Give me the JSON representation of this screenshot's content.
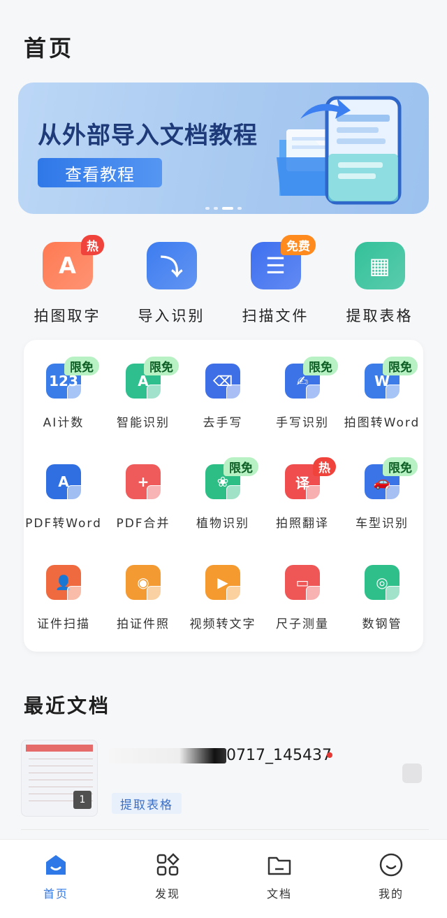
{
  "header": {
    "title": "首页"
  },
  "banner": {
    "title": "从外部导入文档教程",
    "button": "查看教程",
    "slide_count": 4,
    "active_slide": 3
  },
  "top_features": [
    {
      "label": "拍图取字",
      "icon": "photo-text-icon",
      "badge": "热",
      "badge_type": "hot",
      "color": "#ff7a52"
    },
    {
      "label": "导入识别",
      "icon": "import-recognize-icon",
      "badge": "",
      "badge_type": "",
      "color": "#3d7cf0"
    },
    {
      "label": "扫描文件",
      "icon": "scan-file-icon",
      "badge": "免费",
      "badge_type": "free",
      "color": "#3d6ff0"
    },
    {
      "label": "提取表格",
      "icon": "extract-table-icon",
      "badge": "",
      "badge_type": "",
      "color": "#33c19a"
    }
  ],
  "tools": [
    {
      "label": "AI计数",
      "icon": "ai-count-icon",
      "glyph": "123",
      "color": "#3a7de9",
      "badge": "限免",
      "badge_type": "free"
    },
    {
      "label": "智能识别",
      "icon": "smart-recognize-icon",
      "glyph": "A",
      "color": "#2fbf8f",
      "badge": "限免",
      "badge_type": "free"
    },
    {
      "label": "去手写",
      "icon": "remove-handwriting-icon",
      "glyph": "⌫",
      "color": "#3f6fe6",
      "badge": "",
      "badge_type": ""
    },
    {
      "label": "手写识别",
      "icon": "handwriting-recognize-icon",
      "glyph": "✍",
      "color": "#3c74e8",
      "badge": "限免",
      "badge_type": "free"
    },
    {
      "label": "拍图转Word",
      "icon": "photo-to-word-icon",
      "glyph": "W",
      "color": "#3b7ce9",
      "badge": "限免",
      "badge_type": "free"
    },
    {
      "label": "PDF转Word",
      "icon": "pdf-to-word-icon",
      "glyph": "A",
      "color": "#2f6fe2",
      "badge": "",
      "badge_type": ""
    },
    {
      "label": "PDF合并",
      "icon": "pdf-merge-icon",
      "glyph": "+",
      "color": "#ef5a5a",
      "badge": "",
      "badge_type": ""
    },
    {
      "label": "植物识别",
      "icon": "plant-recognize-icon",
      "glyph": "❀",
      "color": "#2dbe86",
      "badge": "限免",
      "badge_type": "free"
    },
    {
      "label": "拍照翻译",
      "icon": "photo-translate-icon",
      "glyph": "译",
      "color": "#f04e4e",
      "badge": "热",
      "badge_type": "hot"
    },
    {
      "label": "车型识别",
      "icon": "car-recognize-icon",
      "glyph": "🚗",
      "color": "#3b74e6",
      "badge": "限免",
      "badge_type": "free"
    },
    {
      "label": "证件扫描",
      "icon": "id-scan-icon",
      "glyph": "👤",
      "color": "#f06a3f",
      "badge": "",
      "badge_type": ""
    },
    {
      "label": "拍证件照",
      "icon": "id-photo-icon",
      "glyph": "◉",
      "color": "#f39a32",
      "badge": "",
      "badge_type": ""
    },
    {
      "label": "视频转文字",
      "icon": "video-to-text-icon",
      "glyph": "▶",
      "color": "#f59a2e",
      "badge": "",
      "badge_type": ""
    },
    {
      "label": "尺子测量",
      "icon": "ruler-measure-icon",
      "glyph": "▭",
      "color": "#ef5656",
      "badge": "",
      "badge_type": ""
    },
    {
      "label": "数钢管",
      "icon": "count-pipes-icon",
      "glyph": "◎",
      "color": "#2fbf8a",
      "badge": "",
      "badge_type": ""
    }
  ],
  "recent": {
    "title": "最近文档",
    "docs": [
      {
        "name_suffix": "0717_145437",
        "pages": "1",
        "tag": "提取表格"
      }
    ]
  },
  "nav": [
    {
      "label": "首页",
      "icon": "home-icon",
      "active": true
    },
    {
      "label": "发现",
      "icon": "discover-icon",
      "active": false
    },
    {
      "label": "文档",
      "icon": "folder-icon",
      "active": false
    },
    {
      "label": "我的",
      "icon": "profile-icon",
      "active": false
    }
  ],
  "colors": {
    "accent": "#2f78e8",
    "hot": "#f0433b",
    "free_badge": "#b8f2c4"
  }
}
